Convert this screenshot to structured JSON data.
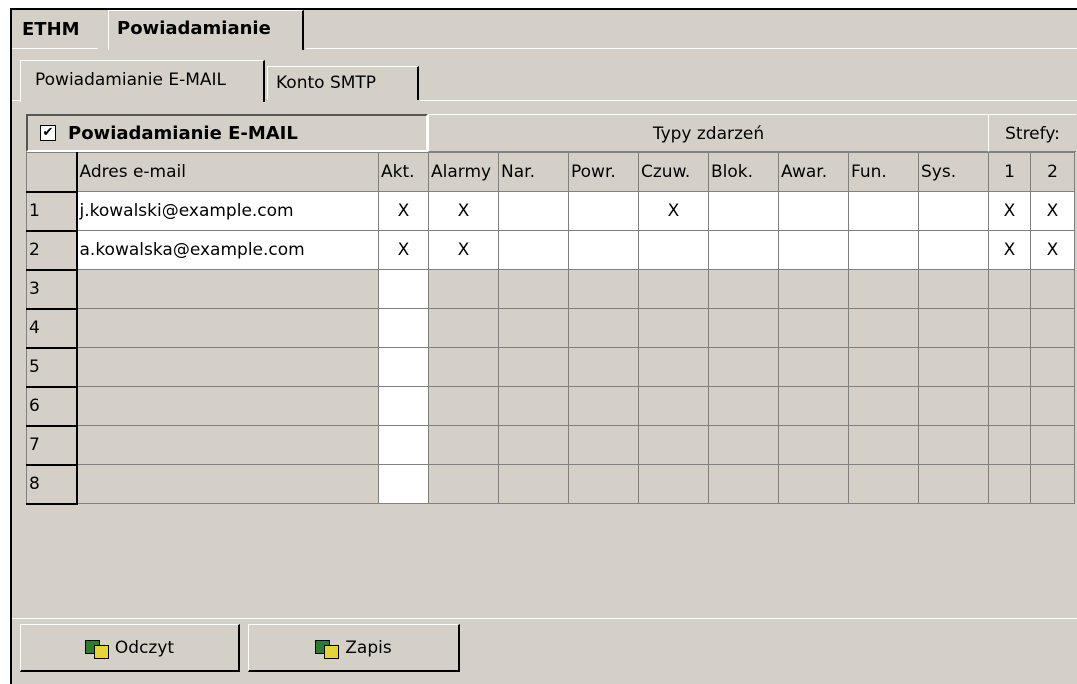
{
  "outer_tabs": [
    "ETHM",
    "Powiadamianie"
  ],
  "inner_tabs": [
    "Powiadamianie E-MAIL",
    "Konto SMTP"
  ],
  "section": {
    "checkbox_mark": "✔",
    "title": "Powiadamianie E-MAIL",
    "event_types_label": "Typy zdarzeń",
    "zones_label": "Strefy:"
  },
  "columns": [
    "Adres e-mail",
    "Akt.",
    "Alarmy",
    "Nar.",
    "Powr.",
    "Czuw.",
    "Blok.",
    "Awar.",
    "Fun.",
    "Sys.",
    "1",
    "2"
  ],
  "rows": [
    {
      "num": "1",
      "email": "j.kowalski@example.com",
      "akt": "X",
      "alarmy": "X",
      "nar": "",
      "powr": "",
      "czuw": "X",
      "blok": "",
      "awar": "",
      "fun": "",
      "sys": "",
      "z1": "X",
      "z2": "X"
    },
    {
      "num": "2",
      "email": "a.kowalska@example.com",
      "akt": "X",
      "alarmy": "X",
      "nar": "",
      "powr": "",
      "czuw": "",
      "blok": "",
      "awar": "",
      "fun": "",
      "sys": "",
      "z1": "X",
      "z2": "X"
    },
    {
      "num": "3"
    },
    {
      "num": "4"
    },
    {
      "num": "5"
    },
    {
      "num": "6"
    },
    {
      "num": "7"
    },
    {
      "num": "8"
    }
  ],
  "buttons": {
    "read": "Odczyt",
    "write": "Zapis"
  }
}
